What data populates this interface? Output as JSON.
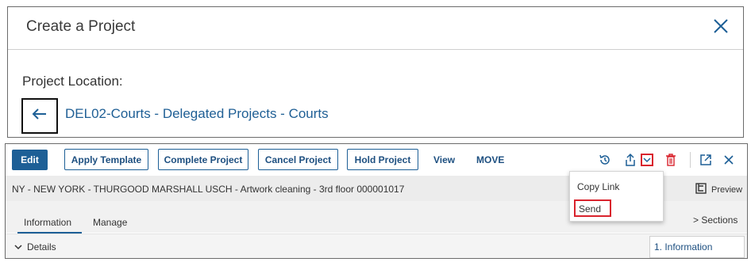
{
  "dialog": {
    "title": "Create a Project",
    "location_label": "Project Location:",
    "location_link": "DEL02-Courts - Delegated Projects - Courts",
    "close_icon": "close-icon",
    "back_icon": "back-arrow-icon"
  },
  "toolbar": {
    "edit_label": "Edit",
    "apply_template_label": "Apply Template",
    "complete_project_label": "Complete Project",
    "cancel_project_label": "Cancel Project",
    "hold_project_label": "Hold Project",
    "view_label": "View",
    "move_label": "MOVE",
    "icons": [
      "history-icon",
      "share-icon",
      "chevron-down-icon",
      "trash-icon",
      "open-external-icon",
      "close-icon"
    ]
  },
  "project": {
    "title": "NY - NEW YORK - THURGOOD MARSHALL USCH - Artwork cleaning - 3rd floor 000001017",
    "preview_label": "Preview"
  },
  "tabs": [
    {
      "label": "Information",
      "active": true
    },
    {
      "label": "Manage",
      "active": false
    }
  ],
  "sections_label": "> Sections",
  "details_label": "Details",
  "section_nav_item": "1. Information",
  "dropdown": {
    "copy_link_label": "Copy Link",
    "send_label": "Send"
  },
  "colors": {
    "primary": "#1d5f96",
    "link": "#1f5f95",
    "highlight": "#d9232d",
    "danger_icon": "#d9232d"
  }
}
